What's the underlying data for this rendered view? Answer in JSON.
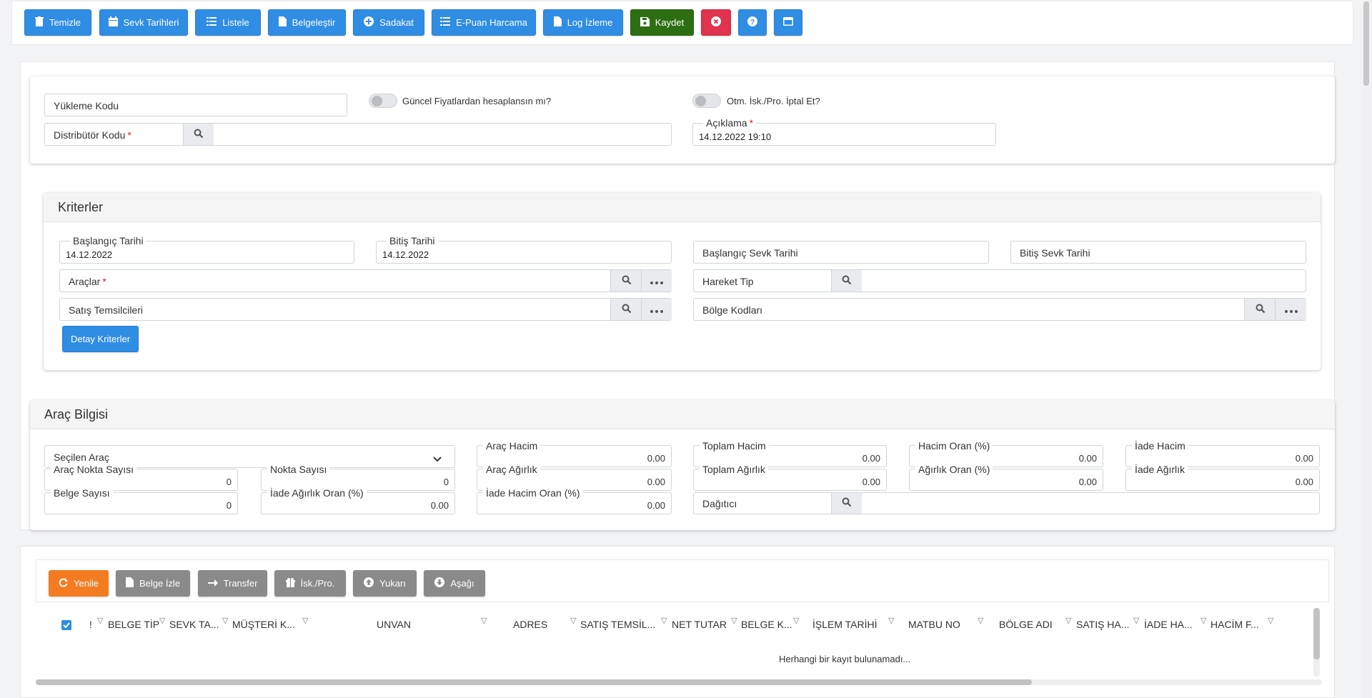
{
  "toolbar": {
    "temizle": "Temizle",
    "sevk_tarihleri": "Sevk Tarihleri",
    "listele": "Listele",
    "belgelestir": "Belgeleştir",
    "sadakat": "Sadakat",
    "e_puan": "E-Puan Harcama",
    "log": "Log İzleme",
    "kaydet": "Kaydet"
  },
  "header_form": {
    "yukleme_kodu": "Yükleme Kodu",
    "guncel_fiyat": "Güncel Fiyatlardan hesaplansın mı?",
    "otm_isk": "Otm. İsk./Pro. İptal Et?",
    "distributor_kodu": "Distribütör Kodu",
    "aciklama_label": "Açıklama",
    "aciklama_value": "14.12.2022 19:10",
    "required_mark": "*"
  },
  "kriterler": {
    "title": "Kriterler",
    "baslangic_tarihi": "Başlangıç Tarihi",
    "baslangic_tarihi_val": "14.12.2022",
    "bitis_tarihi": "Bitiş Tarihi",
    "bitis_tarihi_val": "14.12.2022",
    "baslangic_sevk": "Başlangıç Sevk Tarihi",
    "bitis_sevk": "Bitiş Sevk Tarihi",
    "araclar": "Araçlar",
    "hareket_tip": "Hareket Tip",
    "satis_temsilcileri": "Satış Temsilcileri",
    "bolge_kodlari": "Bölge Kodları",
    "detay_kriterler": "Detay Kriterler"
  },
  "arac_bilgisi": {
    "title": "Araç Bilgisi",
    "secilen_arac": "Seçilen Araç",
    "arac_nokta_sayisi": "Araç Nokta Sayısı",
    "arac_nokta_sayisi_val": "0",
    "nokta_sayisi": "Nokta Sayısı",
    "nokta_sayisi_val": "0",
    "belge_sayisi": "Belge Sayısı",
    "belge_sayisi_val": "0",
    "iade_agirlik_oran": "İade Ağırlık Oran (%)",
    "iade_agirlik_oran_val": "0.00",
    "arac_hacim": "Araç Hacim",
    "arac_hacim_val": "0.00",
    "arac_agirlik": "Araç Ağırlık",
    "arac_agirlik_val": "0.00",
    "iade_hacim_oran": "İade Hacim Oran (%)",
    "iade_hacim_oran_val": "0.00",
    "toplam_hacim": "Toplam Hacim",
    "toplam_hacim_val": "0.00",
    "toplam_agirlik": "Toplam Ağırlık",
    "toplam_agirlik_val": "0.00",
    "hacim_oran": "Hacim Oran (%)",
    "hacim_oran_val": "0.00",
    "agirlik_oran": "Ağırlık Oran (%)",
    "agirlik_oran_val": "0.00",
    "iade_hacim": "İade Hacim",
    "iade_hacim_val": "0.00",
    "iade_agirlik": "İade Ağırlık",
    "iade_agirlik_val": "0.00",
    "dagitici": "Dağıtıcı"
  },
  "grid_toolbar": {
    "yenile": "Yenile",
    "belge_izle": "Belge İzle",
    "transfer": "Transfer",
    "isk_pro": "İsk./Pro.",
    "yukari": "Yukarı",
    "asagi": "Aşağı"
  },
  "grid": {
    "columns": {
      "excl": "!",
      "belge_tip": "BELGE TİP",
      "sevk_ta": "SEVK TA...",
      "musteri_k": "MÜŞTERİ K...",
      "unvan": "UNVAN",
      "adres": "ADRES",
      "satis_temsil": "SATIŞ TEMSİL...",
      "net_tutar": "NET TUTAR",
      "belge_k": "BELGE K...",
      "islem_tarihi": "İŞLEM TARİHİ",
      "matbu_no": "MATBU NO",
      "bolge_adi": "BÖLGE ADI",
      "satis_ha": "SATIŞ HA...",
      "iade_ha": "İADE HA...",
      "hacim_f": "HACİM F..."
    },
    "empty_text": "Herhangi bir kayıt bulunamadı..."
  },
  "colors": {
    "primary": "#2f8de4",
    "success": "#2e6e12",
    "danger": "#e0334d",
    "warning": "#f47c20",
    "secondary": "#8a8a8a"
  }
}
